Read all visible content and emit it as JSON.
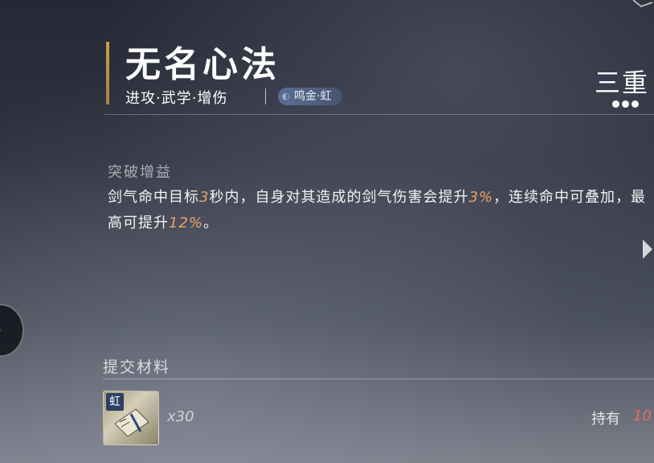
{
  "skill": {
    "name": "无名心法",
    "tags": "进攻·武学·增伤",
    "school_badge": "鸣金·虹",
    "tier": "三重",
    "tier_level": 3
  },
  "breakthrough": {
    "label": "突破增益",
    "desc_1": "剑气命中目标",
    "val_1": "3",
    "desc_2": "秒内，自身对其造成的剑气伤害会提升",
    "val_2": "3%",
    "desc_3": "，连续命中可叠加，最高可提升",
    "val_3": "12%",
    "desc_4": "。"
  },
  "materials": {
    "label": "提交材料",
    "item_badge": "虹",
    "quantity": "x30",
    "own_label": "持有",
    "own_value": "10"
  },
  "colors": {
    "accent_gold": "#c7a14a",
    "highlight_orange": "#e9a266",
    "own_red": "#e56a5a",
    "badge_blue": "#5f78a0"
  },
  "icons": [
    "corner-ornament-icon",
    "right-arrow-icon",
    "left-chevron-icon",
    "material-item-icon"
  ]
}
